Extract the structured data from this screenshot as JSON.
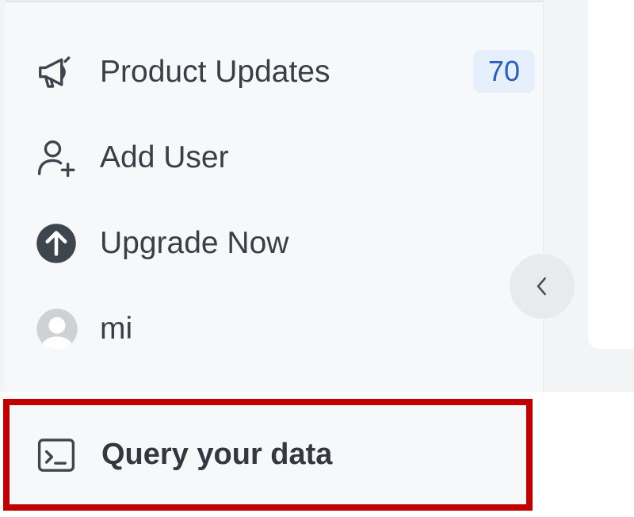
{
  "sidebar": {
    "items": [
      {
        "label": "Product Updates",
        "icon": "megaphone-icon",
        "badge": "70"
      },
      {
        "label": "Add User",
        "icon": "add-user-icon"
      },
      {
        "label": "Upgrade Now",
        "icon": "arrow-up-circle-icon"
      },
      {
        "label": "mi",
        "icon": "avatar"
      }
    ],
    "collapse_icon": "chevron-left-icon"
  },
  "footer": {
    "query_label": "Query your data",
    "query_icon": "terminal-icon",
    "highlight_color": "#c00000"
  },
  "colors": {
    "sidebar_bg": "#f7f8fa",
    "badge_bg": "#e6effc",
    "badge_text": "#2b5ec0",
    "icon_dark": "#3f454d"
  }
}
